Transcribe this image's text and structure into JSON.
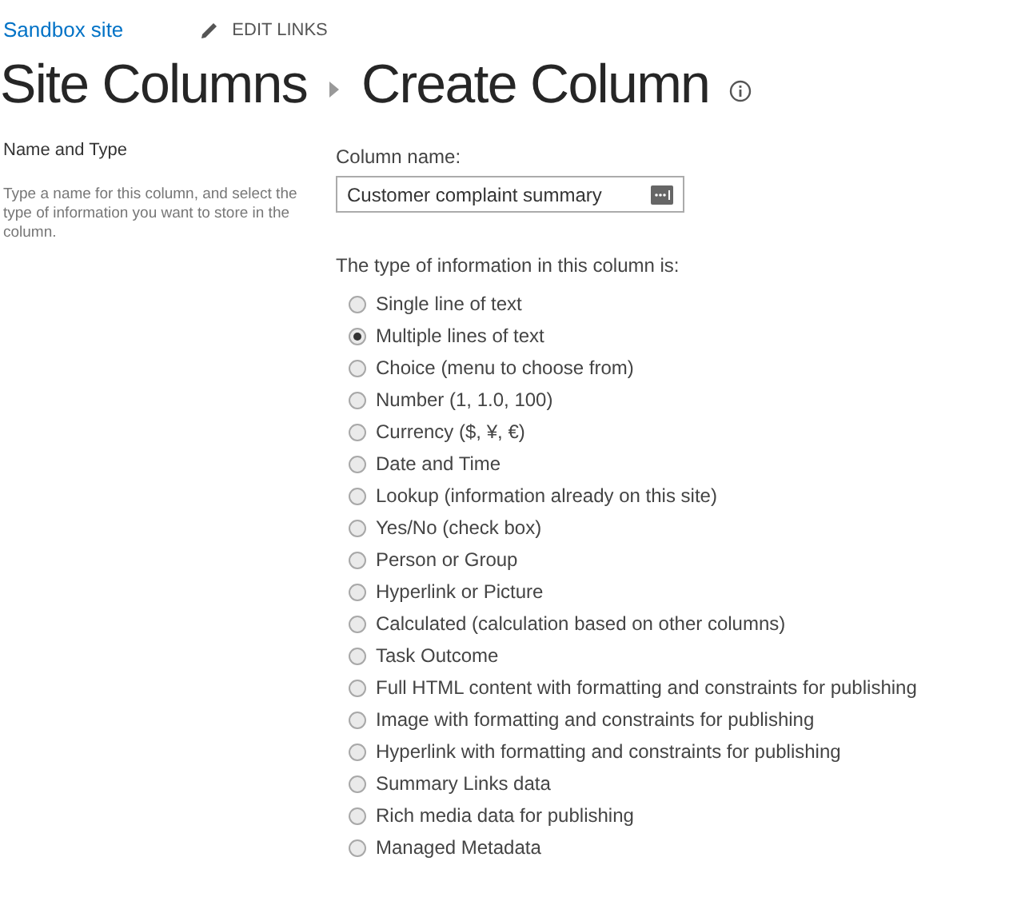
{
  "site_link": "Sandbox site",
  "edit_links": "EDIT LINKS",
  "breadcrumb": [
    "Site Columns",
    "Create Column"
  ],
  "section": {
    "title": "Name and Type",
    "description": "Type a name for this column, and select the type of information you want to store in the column."
  },
  "column_name": {
    "label": "Column name:",
    "value": "Customer complaint summary"
  },
  "type_label": "The type of information in this column is:",
  "types": [
    {
      "label": "Single line of text",
      "selected": false
    },
    {
      "label": "Multiple lines of text",
      "selected": true
    },
    {
      "label": "Choice (menu to choose from)",
      "selected": false
    },
    {
      "label": "Number (1, 1.0, 100)",
      "selected": false
    },
    {
      "label": "Currency ($, ¥, €)",
      "selected": false
    },
    {
      "label": "Date and Time",
      "selected": false
    },
    {
      "label": "Lookup (information already on this site)",
      "selected": false
    },
    {
      "label": "Yes/No (check box)",
      "selected": false
    },
    {
      "label": "Person or Group",
      "selected": false
    },
    {
      "label": "Hyperlink or Picture",
      "selected": false
    },
    {
      "label": "Calculated (calculation based on other columns)",
      "selected": false
    },
    {
      "label": "Task Outcome",
      "selected": false
    },
    {
      "label": "Full HTML content with formatting and constraints for publishing",
      "selected": false
    },
    {
      "label": "Image with formatting and constraints for publishing",
      "selected": false
    },
    {
      "label": "Hyperlink with formatting and constraints for publishing",
      "selected": false
    },
    {
      "label": "Summary Links data",
      "selected": false
    },
    {
      "label": "Rich media data for publishing",
      "selected": false
    },
    {
      "label": "Managed Metadata",
      "selected": false
    }
  ]
}
